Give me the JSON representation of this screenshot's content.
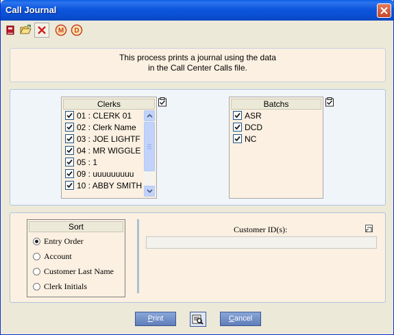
{
  "window": {
    "title": "Call Journal"
  },
  "toolbar": {
    "buttons": [
      {
        "icon": "book-icon"
      },
      {
        "icon": "open-folder-icon"
      },
      {
        "icon": "delete-icon"
      },
      {
        "icon": "m-circle-icon"
      },
      {
        "icon": "d-circle-icon"
      }
    ]
  },
  "description": {
    "line1": "This process prints a journal using the data",
    "line2": "in the Call Center Calls file."
  },
  "clerks": {
    "header": "Clerks",
    "items": [
      {
        "label": "01 : CLERK 01",
        "checked": true
      },
      {
        "label": "02 : Clerk Name",
        "checked": true
      },
      {
        "label": "03 : JOE LIGHTF",
        "checked": true
      },
      {
        "label": "04 : MR WIGGLE",
        "checked": true
      },
      {
        "label": "05 : 1",
        "checked": true
      },
      {
        "label": "09 : uuuuuuuuu",
        "checked": true
      },
      {
        "label": "10 : ABBY SMITH",
        "checked": true
      }
    ]
  },
  "batchs": {
    "header": "Batchs",
    "items": [
      {
        "label": "ASR",
        "checked": true
      },
      {
        "label": "DCD",
        "checked": true
      },
      {
        "label": "NC",
        "checked": true
      }
    ]
  },
  "sort": {
    "header": "Sort",
    "options": [
      {
        "label": "Entry Order",
        "selected": true
      },
      {
        "label": "Account",
        "selected": false
      },
      {
        "label": "Customer Last Name",
        "selected": false
      },
      {
        "label": "Clerk Initials",
        "selected": false
      }
    ]
  },
  "customer": {
    "label": "Customer ID(s):",
    "value": ""
  },
  "buttons": {
    "print_first": "P",
    "print_rest": "rint",
    "cancel_first": "C",
    "cancel_rest": "ancel"
  }
}
